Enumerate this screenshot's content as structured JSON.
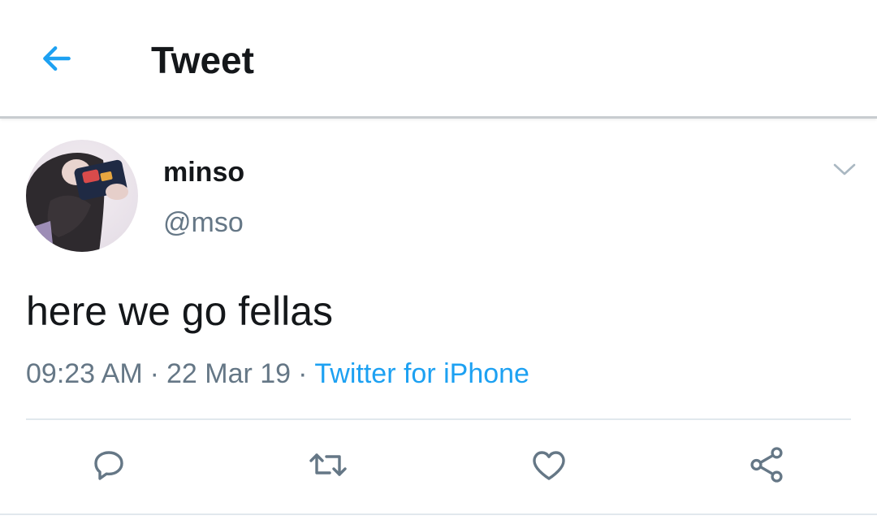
{
  "header": {
    "title": "Tweet",
    "back_icon": "back-arrow-icon"
  },
  "tweet": {
    "author": {
      "display_name": "minso",
      "handle": "@mso"
    },
    "text": "here we go fellas",
    "time": "09:23 AM",
    "date": "22 Mar 19",
    "separator": "·",
    "source": "Twitter for iPhone"
  },
  "actions": [
    {
      "name": "reply",
      "icon": "reply-icon"
    },
    {
      "name": "retweet",
      "icon": "retweet-icon"
    },
    {
      "name": "like",
      "icon": "heart-icon"
    },
    {
      "name": "share",
      "icon": "share-icon"
    }
  ],
  "colors": {
    "accent": "#1da1f2",
    "text_primary": "#14171a",
    "text_secondary": "#657786",
    "icon_gray": "#657786",
    "divider": "#e1e8ed"
  }
}
